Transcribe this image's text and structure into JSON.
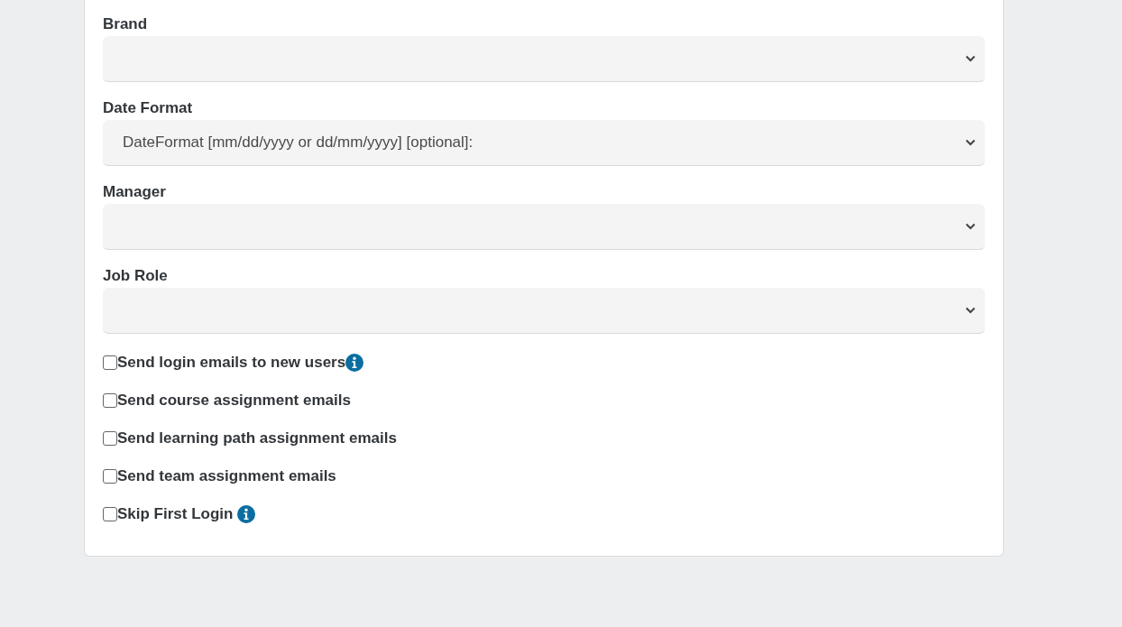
{
  "fields": [
    {
      "label": "Brand"
    },
    {
      "label": "Date Format",
      "value": "DateFormat [mm/dd/yyyy or dd/mm/yyyy] [optional]:"
    },
    {
      "label": "Manager"
    },
    {
      "label": "Job Role"
    }
  ],
  "checkboxes": [
    {
      "label": "Send login emails to new users",
      "checked": false,
      "kind": "tight"
    },
    {
      "label": "Send course assignment emails",
      "checked": false,
      "kind": "plain"
    },
    {
      "label": "Send learning path assignment emails",
      "checked": false,
      "kind": "plain"
    },
    {
      "label": "Send team assignment emails",
      "checked": false,
      "kind": "plain"
    },
    {
      "label": "Skip First Login",
      "checked": false,
      "kind": "spaced"
    }
  ]
}
